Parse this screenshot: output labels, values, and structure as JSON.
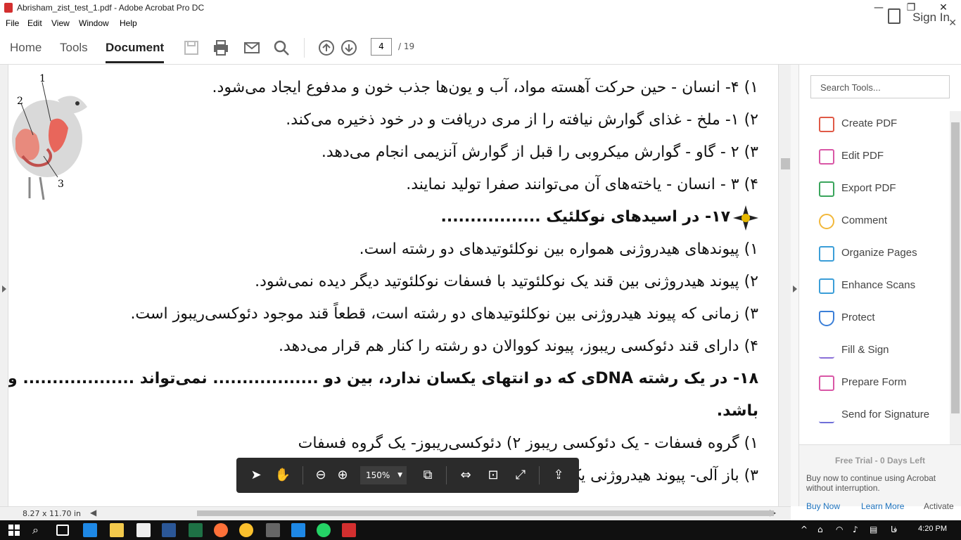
{
  "window": {
    "title": "Abrisham_zist_test_1.pdf - Adobe Acrobat Pro DC",
    "controls": [
      "minimize",
      "restore",
      "close"
    ]
  },
  "menu": [
    "File",
    "Edit",
    "View",
    "Window",
    "Help"
  ],
  "toolbar": {
    "tabs": [
      "Home",
      "Tools",
      "Document"
    ],
    "active_tab": "Document",
    "page_current": "4",
    "page_total": "/ 19",
    "sign_in": "Sign In"
  },
  "document": {
    "lines": [
      {
        "text": "۱) ۴- انسان - حین حرکت آهسته مواد، آب و یون‌ها جذب خون و مدفوع ایجاد می‌شود.",
        "bold": false
      },
      {
        "text": "۲) ۱- ملخ - غذای گوارش نیافته را از مری دریافت و در خود ذخیره می‌کند.",
        "bold": false
      },
      {
        "text": "۳) ۲ - گاو - گوارش میکروبی را قبل از گوارش آنزیمی انجام می‌دهد.",
        "bold": false
      },
      {
        "text": "۴) ۳ - انسان - یاخته‌های آن می‌توانند صفرا تولید نمایند.",
        "bold": false
      },
      {
        "text": "۱۷- در اسیدهای نوکلئیک .................",
        "bold": true
      },
      {
        "text": "۱) پیوندهای هیدروژنی همواره بین نوکلئوتیدهای دو رشته است.",
        "bold": false
      },
      {
        "text": "۲) پیوند هیدروژنی بین قند یک نوکلئوتید با فسفات نوکلئوتید دیگر دیده نمی‌شود.",
        "bold": false
      },
      {
        "text": "۳) زمانی که پیوند هیدروژنی بین نوکلئوتیدهای دو رشته است، قطعاً قند موجود دئوکسی‌ریبوز است.",
        "bold": false
      },
      {
        "text": "۴) دارای قند دئوکسی ریبوز، پیوند کووالان دو رشته را کنار هم قرار می‌دهد.",
        "bold": false
      },
      {
        "text": "۱۸- در یک رشته DNAی که دو انتهای یکسان ندارد، بین دو .................. نمی‌تواند ................... وج",
        "bold": true
      },
      {
        "text": "باشد.",
        "bold": true
      },
      {
        "text": "۱) گروه فسفات - یک دئوکسی ریبوز           ۲) دئوکسی‌ریبوز- یک گروه فسفات",
        "bold": false
      },
      {
        "text": "۳) باز آلی- پیوند هیدروژنی                  یک نوکلئوتید",
        "bold": false
      }
    ],
    "figure_labels": [
      "1",
      "2",
      "3"
    ]
  },
  "status": {
    "page_size": "8.27 x 11.70 in"
  },
  "floating_toolbar": {
    "zoom": "150%"
  },
  "tools_pane": {
    "search_placeholder": "Search Tools...",
    "items": [
      {
        "label": "Create PDF",
        "icon": "create-pdf-icon",
        "color": "#e05a47"
      },
      {
        "label": "Edit PDF",
        "icon": "edit-pdf-icon",
        "color": "#d957a6"
      },
      {
        "label": "Export PDF",
        "icon": "export-pdf-icon",
        "color": "#3aa55c"
      },
      {
        "label": "Comment",
        "icon": "comment-icon",
        "color": "#f2b83b"
      },
      {
        "label": "Organize Pages",
        "icon": "organize-pages-icon",
        "color": "#3b9ed8"
      },
      {
        "label": "Enhance Scans",
        "icon": "enhance-scans-icon",
        "color": "#3b9ed8"
      },
      {
        "label": "Protect",
        "icon": "protect-icon",
        "color": "#3b7fd8"
      },
      {
        "label": "Fill & Sign",
        "icon": "fill-sign-icon",
        "color": "#8a6fd8"
      },
      {
        "label": "Prepare Form",
        "icon": "prepare-form-icon",
        "color": "#d957a6"
      },
      {
        "label": "Send for Signature",
        "icon": "send-signature-icon",
        "color": "#6f6fd8"
      }
    ],
    "trial_title": "Free Trial - 0 Days Left",
    "trial_desc": "Buy now to continue using Acrobat without interruption.",
    "buy_now": "Buy Now",
    "learn_more": "Learn More",
    "activate": "Activate"
  },
  "taskbar": {
    "time": "4:20 PM",
    "lang": "فا"
  }
}
